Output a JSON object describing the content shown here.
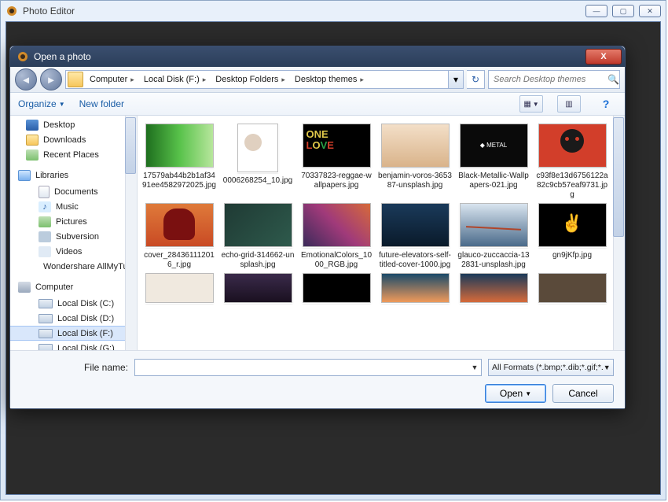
{
  "outer_window": {
    "title": "Photo Editor",
    "backdrop_text": "Photo Editor"
  },
  "dialog": {
    "title": "Open a photo",
    "breadcrumbs": [
      "Computer",
      "Local Disk (F:)",
      "Desktop Folders",
      "Desktop themes"
    ],
    "search_placeholder": "Search Desktop themes",
    "organize": "Organize",
    "new_folder": "New folder",
    "tree": {
      "favorites": [
        {
          "label": "Desktop",
          "icon": "desktop"
        },
        {
          "label": "Downloads",
          "icon": "down"
        },
        {
          "label": "Recent Places",
          "icon": "recent"
        }
      ],
      "libraries_header": "Libraries",
      "libraries": [
        {
          "label": "Documents",
          "icon": "doc"
        },
        {
          "label": "Music",
          "icon": "music",
          "glyph": "♪"
        },
        {
          "label": "Pictures",
          "icon": "pic"
        },
        {
          "label": "Subversion",
          "icon": "sub"
        },
        {
          "label": "Videos",
          "icon": "vid"
        },
        {
          "label": "Wondershare AllMyTube",
          "icon": "ws"
        }
      ],
      "computer_header": "Computer",
      "drives": [
        {
          "label": "Local Disk (C:)"
        },
        {
          "label": "Local Disk (D:)"
        },
        {
          "label": "Local Disk (F:)",
          "selected": true
        },
        {
          "label": "Local Disk (G:)"
        }
      ]
    },
    "files": [
      {
        "name": "17579ab44b2b1af3491ee4582972025.jpg",
        "bg": "linear-gradient(90deg,#1e6e1e,#58c24a,#b7e69c)"
      },
      {
        "name": "0006268254_10.jpg",
        "bg": "#f4f4f4",
        "portrait": true
      },
      {
        "name": "70337823-reggae-wallpapers.jpg",
        "bg": "#000",
        "overlay": "ONE LOVE",
        "colors": [
          "#e0c84a",
          "#2aa047",
          "#d23e2a"
        ]
      },
      {
        "name": "benjamin-voros-365387-unsplash.jpg",
        "bg": "linear-gradient(#f3dfc8,#d9b38a)"
      },
      {
        "name": "Black-Metallic-Wallpapers-021.jpg",
        "bg": "#0a0a0a",
        "dot": true
      },
      {
        "name": "c93f8e13d6756122a82c9cb57eaf9731.jpg",
        "bg": "#d23e2a",
        "face": true
      },
      {
        "name": "cover_284361112016_r.jpg",
        "bg": "linear-gradient(#df7a3a,#c94a24)",
        "fist": true
      },
      {
        "name": "echo-grid-314662-unsplash.jpg",
        "bg": "linear-gradient(135deg,#1f3a34,#2e5a4c)"
      },
      {
        "name": "EmotionalColors_1000_RGB.jpg",
        "bg": "linear-gradient(45deg,#3b2a5a,#a03a7a,#d66a3a)"
      },
      {
        "name": "future-elevators-self-titled-cover-1000.jpg",
        "bg": "linear-gradient(#1a3a5a,#0a1a2a)"
      },
      {
        "name": "glauco-zuccaccia-132831-unsplash.jpg",
        "bg": "linear-gradient(#d8e4ef,#4a6a8a)",
        "bridge": true
      },
      {
        "name": "gn9jKfp.jpg",
        "bg": "#000",
        "peace": true
      },
      {
        "name": "",
        "bg": "#f0e9df",
        "partial": true
      },
      {
        "name": "",
        "bg": "linear-gradient(#3a2a4a,#1a1020)",
        "partial": true
      },
      {
        "name": "",
        "bg": "#000",
        "partial": true
      },
      {
        "name": "",
        "bg": "linear-gradient(#1a4a6a,#f09a5a)",
        "partial": true
      },
      {
        "name": "",
        "bg": "linear-gradient(#1a3a5a,#d66a3a)",
        "partial": true
      },
      {
        "name": "",
        "bg": "#5a4a3a",
        "partial": true
      }
    ],
    "footer": {
      "filename_label": "File name:",
      "filename_value": "",
      "format_label": "All Formats (*.bmp;*.dib;*.gif;*.",
      "open": "Open",
      "cancel": "Cancel"
    }
  }
}
